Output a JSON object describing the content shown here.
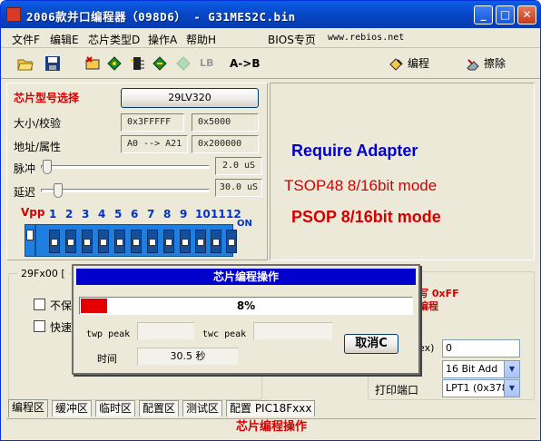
{
  "window": {
    "title": "2006款并口编程器（098D6） - G31MES2C.bin",
    "minimize": "_",
    "maximize": "□",
    "close": "✕"
  },
  "menu": {
    "file": "文件F",
    "edit": "编辑E",
    "chip_type": "芯片类型D",
    "operate": "操作A",
    "help": "帮助H",
    "bios": "BIOS专页",
    "site": "www.rebios.net"
  },
  "toolbar": {
    "lb": "LB",
    "a_to_b": "A->B",
    "program": "编程",
    "erase": "擦除",
    "icons": [
      "open-icon",
      "save-icon",
      "read-chip-icon",
      "verify-icon",
      "blank-check-icon",
      "chip-id-icon",
      "protect-icon"
    ]
  },
  "chip": {
    "select_label": "芯片型号选择",
    "model": "29LV320",
    "size_label": "大小/校验",
    "size": "0x3FFFFF",
    "checksum": "0x5000",
    "addr_label": "地址/属性",
    "addr": "A0 --> A21",
    "attr": "0x200000",
    "pulse_label": "脉冲",
    "pulse_value": "2.0 uS",
    "delay_label": "延迟",
    "delay_value": "30.0 uS",
    "vpp_label": "Vpp",
    "on_label": "ON",
    "dip_numbers": [
      "1",
      "2",
      "3",
      "4",
      "5",
      "6",
      "7",
      "8",
      "9",
      "10",
      "11",
      "12"
    ]
  },
  "adapter": {
    "title": "Require Adapter",
    "tsop": "TSOP48 8/16bit mode",
    "psop": "PSOP 8/16bit mode"
  },
  "options": {
    "legend": "29Fx00 [",
    "opt1": "不保",
    "opt2": "快速",
    "right_red1": "写 0xFF",
    "right_red2": "编程",
    "hex_label": "ex)",
    "hex_value": "0",
    "bit_mode": "16 Bit Add",
    "port_label": "打印端口",
    "port": "LPT1 (0x378)"
  },
  "tabs": [
    "编程区",
    "缓冲区",
    "临时区",
    "配置区",
    "测试区",
    "配置 PIC18Fxxx"
  ],
  "status": "芯片编程操作",
  "dialog": {
    "title": "芯片编程操作",
    "progress_percent": 8,
    "progress_text": "8%",
    "twp_label": "twp peak",
    "twc_label": "twc peak",
    "time_label": "时间",
    "time_value": "30.5 秒",
    "cancel": "取消C"
  },
  "colors": {
    "title_blue": "#0846c6",
    "red": "#d40000",
    "dialog_title": "#0000cc",
    "progress": "#e40000",
    "adapter_blue": "#0000cc"
  }
}
